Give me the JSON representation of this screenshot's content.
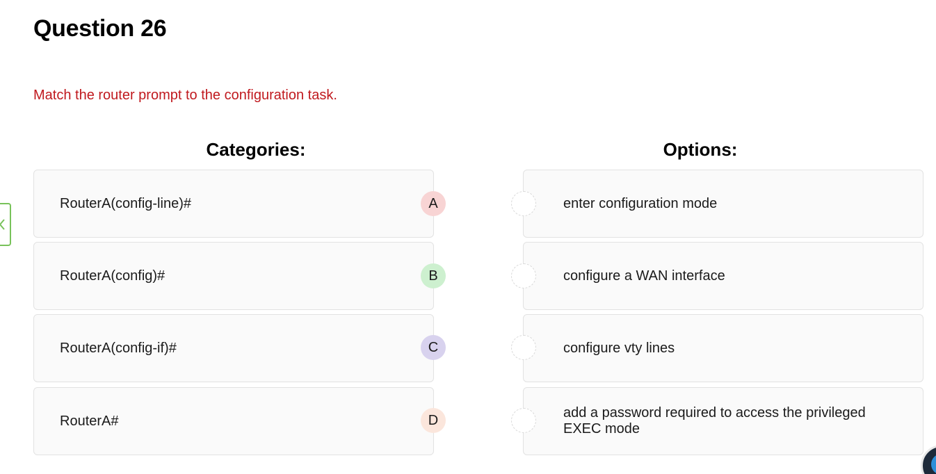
{
  "question": {
    "title": "Question 26",
    "instruction": "Match the router prompt to the configuration task."
  },
  "headings": {
    "categories": "Categories:",
    "options": "Options:"
  },
  "categories": [
    {
      "label": "RouterA(config-line)#",
      "letter": "A",
      "badge_color": "#f8d4d4"
    },
    {
      "label": "RouterA(config)#",
      "letter": "B",
      "badge_color": "#cdf0cf"
    },
    {
      "label": "RouterA(config-if)#",
      "letter": "C",
      "badge_color": "#d8d2ee"
    },
    {
      "label": "RouterA#",
      "letter": "D",
      "badge_color": "#fbe6dc"
    }
  ],
  "options": [
    {
      "label": "enter configuration mode"
    },
    {
      "label": "configure a WAN interface"
    },
    {
      "label": "configure vty lines"
    },
    {
      "label": "add a password required to access the privileged EXEC mode"
    }
  ],
  "colors": {
    "instruction": "#c0191e",
    "side_tab_border": "#78c25a"
  },
  "icons": {
    "side_tab": "chevron-left-icon",
    "corner": "app-logo-icon"
  }
}
